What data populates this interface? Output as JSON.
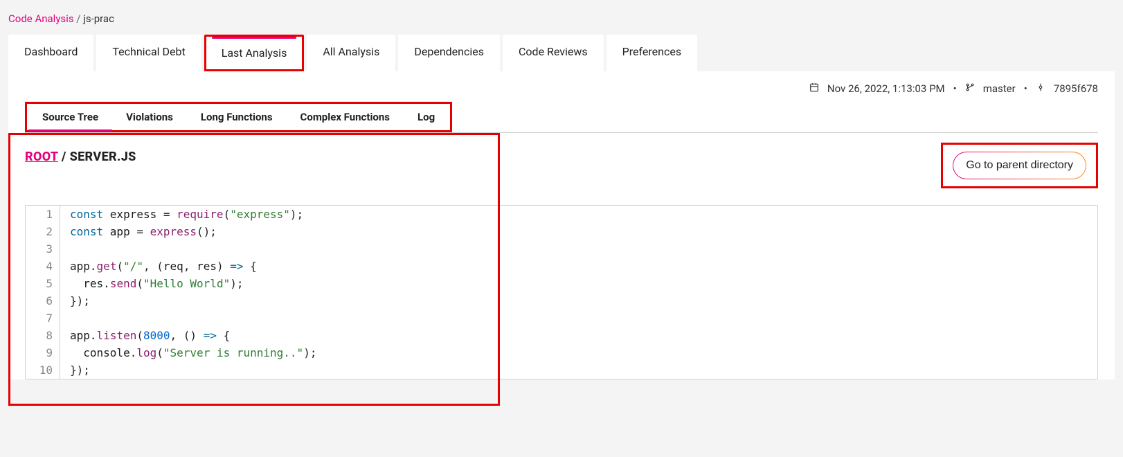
{
  "breadcrumb": {
    "root": "Code Analysis",
    "separator": "/",
    "current": "js-prac"
  },
  "primary_tabs": [
    {
      "label": "Dashboard",
      "active": false
    },
    {
      "label": "Technical Debt",
      "active": false
    },
    {
      "label": "Last Analysis",
      "active": true
    },
    {
      "label": "All Analysis",
      "active": false
    },
    {
      "label": "Dependencies",
      "active": false
    },
    {
      "label": "Code Reviews",
      "active": false
    },
    {
      "label": "Preferences",
      "active": false
    }
  ],
  "meta": {
    "datetime": "Nov 26, 2022, 1:13:03 PM",
    "branch": "master",
    "commit": "7895f678"
  },
  "secondary_tabs": [
    {
      "label": "Source Tree",
      "active": true
    },
    {
      "label": "Violations",
      "active": false
    },
    {
      "label": "Long Functions",
      "active": false
    },
    {
      "label": "Complex Functions",
      "active": false
    },
    {
      "label": "Log",
      "active": false
    }
  ],
  "file_path": {
    "root": "ROOT",
    "slash": "/",
    "file": "SERVER.JS"
  },
  "parent_button_label": "Go to parent directory",
  "code": [
    {
      "n": 1,
      "tokens": [
        {
          "t": "const ",
          "c": "tok-kw"
        },
        {
          "t": "express ",
          "c": "tok-id"
        },
        {
          "t": "= ",
          "c": ""
        },
        {
          "t": "require",
          "c": "tok-call"
        },
        {
          "t": "(",
          "c": ""
        },
        {
          "t": "\"express\"",
          "c": "tok-str"
        },
        {
          "t": ");",
          "c": ""
        }
      ]
    },
    {
      "n": 2,
      "tokens": [
        {
          "t": "const ",
          "c": "tok-kw"
        },
        {
          "t": "app ",
          "c": "tok-id"
        },
        {
          "t": "= ",
          "c": ""
        },
        {
          "t": "express",
          "c": "tok-call"
        },
        {
          "t": "();",
          "c": ""
        }
      ]
    },
    {
      "n": 3,
      "tokens": []
    },
    {
      "n": 4,
      "tokens": [
        {
          "t": "app",
          "c": "tok-id"
        },
        {
          "t": ".",
          "c": ""
        },
        {
          "t": "get",
          "c": "tok-call"
        },
        {
          "t": "(",
          "c": ""
        },
        {
          "t": "\"/\"",
          "c": "tok-str"
        },
        {
          "t": ", (",
          "c": ""
        },
        {
          "t": "req",
          "c": "tok-id"
        },
        {
          "t": ", ",
          "c": ""
        },
        {
          "t": "res",
          "c": "tok-id"
        },
        {
          "t": ") ",
          "c": ""
        },
        {
          "t": "=>",
          "c": "tok-kw"
        },
        {
          "t": " {",
          "c": ""
        }
      ]
    },
    {
      "n": 5,
      "tokens": [
        {
          "t": "  res",
          "c": "tok-id"
        },
        {
          "t": ".",
          "c": ""
        },
        {
          "t": "send",
          "c": "tok-call"
        },
        {
          "t": "(",
          "c": ""
        },
        {
          "t": "\"Hello World\"",
          "c": "tok-str"
        },
        {
          "t": ");",
          "c": ""
        }
      ]
    },
    {
      "n": 6,
      "tokens": [
        {
          "t": "});",
          "c": ""
        }
      ]
    },
    {
      "n": 7,
      "tokens": []
    },
    {
      "n": 8,
      "tokens": [
        {
          "t": "app",
          "c": "tok-id"
        },
        {
          "t": ".",
          "c": ""
        },
        {
          "t": "listen",
          "c": "tok-call"
        },
        {
          "t": "(",
          "c": ""
        },
        {
          "t": "8000",
          "c": "tok-num"
        },
        {
          "t": ", () ",
          "c": ""
        },
        {
          "t": "=>",
          "c": "tok-kw"
        },
        {
          "t": " {",
          "c": ""
        }
      ]
    },
    {
      "n": 9,
      "tokens": [
        {
          "t": "  console",
          "c": "tok-id"
        },
        {
          "t": ".",
          "c": ""
        },
        {
          "t": "log",
          "c": "tok-call"
        },
        {
          "t": "(",
          "c": ""
        },
        {
          "t": "\"Server is running..\"",
          "c": "tok-str"
        },
        {
          "t": ");",
          "c": ""
        }
      ]
    },
    {
      "n": 10,
      "tokens": [
        {
          "t": "});",
          "c": ""
        }
      ]
    }
  ]
}
